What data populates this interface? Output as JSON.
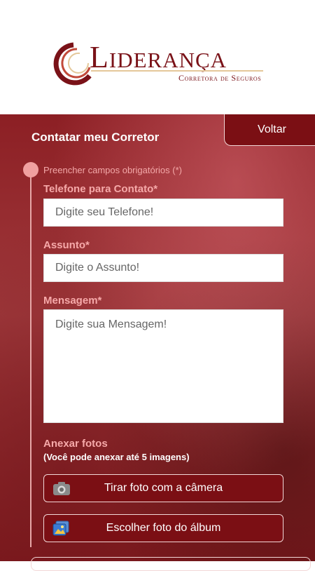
{
  "logo": {
    "name": "Liderança",
    "subtitle": "Corretora de Seguros"
  },
  "header": {
    "back_label": "Voltar",
    "title": "Contatar meu Corretor"
  },
  "form": {
    "required_note": "Preencher campos obrigatórios (*)",
    "phone": {
      "label": "Telefone para Contato",
      "placeholder": "Digite seu Telefone!"
    },
    "subject": {
      "label": "Assunto",
      "placeholder": "Digite o Assunto!"
    },
    "message": {
      "label": "Mensagem",
      "placeholder": "Digite sua Mensagem!"
    },
    "required_mark": "*"
  },
  "attach": {
    "title": "Anexar fotos",
    "subtitle": "(Você pode anexar até 5 imagens)",
    "camera_label": "Tirar foto com a câmera",
    "album_label": "Escolher foto do álbum"
  },
  "colors": {
    "brand": "#7b0f14",
    "accent_label": "#f6a9a9",
    "timeline": "#f0a0a0"
  },
  "icons": {
    "camera": "camera-icon",
    "album": "photo-album-icon"
  }
}
